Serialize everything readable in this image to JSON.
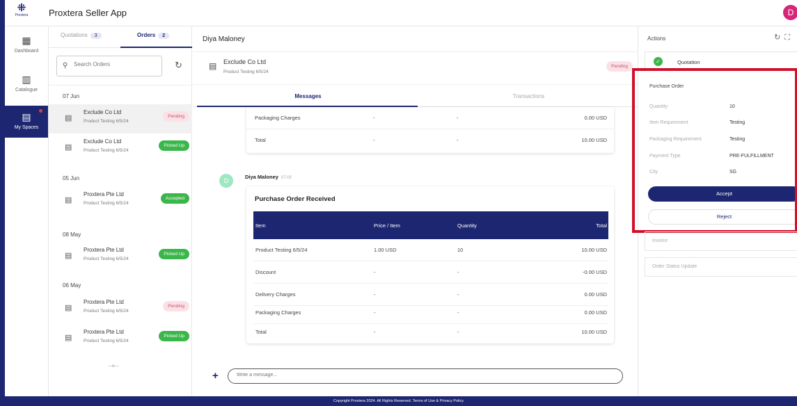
{
  "app": {
    "title": "Proxtera Seller App",
    "logo_text": "Proxtera",
    "user_initial": "D"
  },
  "nav": [
    {
      "label": "Dashboard",
      "icon": "grid-icon"
    },
    {
      "label": "Catalogue",
      "icon": "book-icon"
    },
    {
      "label": "My Spaces",
      "icon": "chat-icon",
      "active": true
    }
  ],
  "list": {
    "tabs": [
      {
        "label": "Quotations",
        "count": "3"
      },
      {
        "label": "Orders",
        "count": "2"
      }
    ],
    "search_placeholder": "Search Orders",
    "groups": [
      {
        "date": "07 Jun",
        "orders": [
          {
            "name": "Exclude Co Ltd",
            "sub": "Product Testing 6/5/24",
            "status": "Pending"
          },
          {
            "name": "Exclude Co Ltd",
            "sub": "Product Testing 6/5/24",
            "status": "Picked Up"
          }
        ]
      },
      {
        "date": "05 Jun",
        "orders": [
          {
            "name": "Proxtera Pte Ltd",
            "sub": "Product Testing 6/5/24",
            "status": "Accepted"
          }
        ]
      },
      {
        "date": "08 May",
        "orders": [
          {
            "name": "Proxtera Pte Ltd",
            "sub": "Product Testing 6/5/24",
            "status": "Picked Up"
          }
        ]
      },
      {
        "date": "06 May",
        "orders": [
          {
            "name": "Proxtera Pte Ltd",
            "sub": "Product Testing 6/5/24",
            "status": "Pending"
          },
          {
            "name": "Proxtera Pte Ltd",
            "sub": "Product Testing 6/5/24",
            "status": "Picked Up"
          }
        ]
      }
    ],
    "end_marker": "---o---"
  },
  "chat": {
    "contact": "Diya Maloney",
    "order": {
      "name": "Exclude Co Ltd",
      "sub": "Product Testing 6/5/24",
      "status": "Pending"
    },
    "tabs": [
      "Messages",
      "Transactions"
    ],
    "prev_rows": [
      {
        "item": "Packaging Charges",
        "price": "-",
        "qty": "-",
        "total": "0.00 USD"
      },
      {
        "item": "Total",
        "price": "-",
        "qty": "-",
        "total": "10.00 USD"
      }
    ],
    "message": {
      "sender": "Diya Maloney",
      "avatar": "D",
      "time": "07:05",
      "title": "Purchase Order Received",
      "headers": [
        "Item",
        "Price / Item",
        "Quantity",
        "Total"
      ],
      "rows": [
        {
          "item": "Product Testing 6/5/24",
          "price": "1.00 USD",
          "qty": "10",
          "total": "10.00 USD"
        },
        {
          "item": "Discount",
          "price": "-",
          "qty": "-",
          "total": "-0.00 USD"
        },
        {
          "item": "Delivery Charges",
          "price": "-",
          "qty": "-",
          "total": "0.00 USD"
        },
        {
          "item": "Packaging Charges",
          "price": "-",
          "qty": "-",
          "total": "0.00 USD"
        },
        {
          "item": "Total",
          "price": "-",
          "qty": "-",
          "total": "10.00 USD"
        }
      ]
    },
    "input_placeholder": "Write a message..."
  },
  "actions": {
    "title": "Actions",
    "quotation_label": "Quotation",
    "po_title": "Purchase Order",
    "fields": [
      {
        "key": "Quantity",
        "value": "10"
      },
      {
        "key": "Item Requirement",
        "value": "Testing"
      },
      {
        "key": "Packaging Requirement",
        "value": "Testing"
      },
      {
        "key": "Payment Type",
        "value": "PRE-FULFILLMENT"
      },
      {
        "key": "City",
        "value": "SG"
      }
    ],
    "accept_label": "Accept",
    "reject_label": "Reject",
    "invoice_label": "Invoice",
    "status_update_label": "Order Status Update"
  },
  "footer": "Copyright Proxtera 2024. All Rights Reserved. Terms of Use & Privacy Policy",
  "colors": {
    "primary": "#1d2670",
    "success": "#3bb64a",
    "pending_bg": "#fbe1e6",
    "highlight": "#d0102a"
  }
}
